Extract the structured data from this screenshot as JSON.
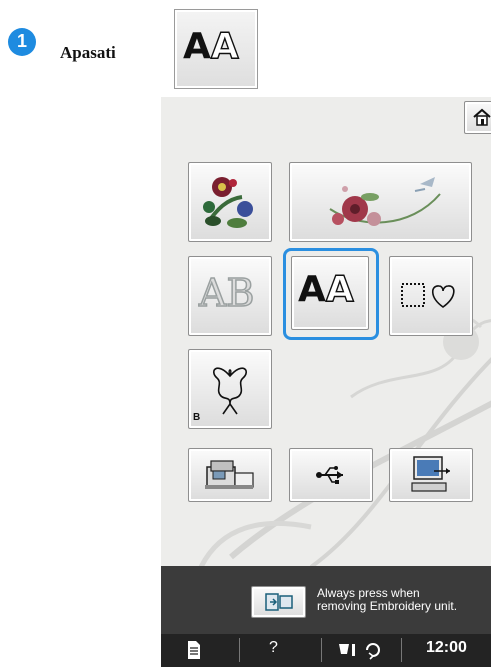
{
  "instruction": {
    "step_number": "1",
    "text": "Apasati",
    "key_glyph_solid": "A",
    "key_glyph_outline": "A"
  },
  "screen": {
    "home_button_icon": "home-icon",
    "pattern_buttons": [
      {
        "name": "floral-embroidery-patterns",
        "icon": "flower-icon"
      },
      {
        "name": "large-floral-embroidery-patterns",
        "icon": "floral-bird-icon"
      },
      {
        "name": "alphabet-decorative-patterns",
        "icon": "decorative-ab-icon",
        "label": "AB"
      },
      {
        "name": "character-patterns",
        "icon": "aa-letters-icon",
        "solid": "A",
        "outline": "A",
        "selected": true
      },
      {
        "name": "frame-patterns",
        "icon": "frame-heart-icon"
      },
      {
        "name": "built-in-b-patterns",
        "icon": "damask-icon",
        "badge": "B"
      },
      {
        "name": "machine-memory",
        "icon": "sewing-machine-icon"
      },
      {
        "name": "usb-media",
        "icon": "usb-icon"
      },
      {
        "name": "computer",
        "icon": "computer-usb-icon"
      }
    ],
    "notice": {
      "line1": "Always press when",
      "line2": "removing Embroidery unit.",
      "icon": "embroidery-unit-icon"
    },
    "status_bar": {
      "help": "?",
      "time": "12:00"
    }
  }
}
